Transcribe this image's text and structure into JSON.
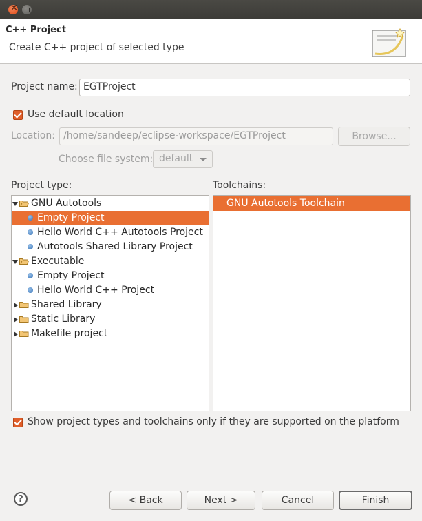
{
  "window": {
    "close_icon": "close-icon",
    "minimize_icon": "minimize-icon"
  },
  "header": {
    "title": "C++ Project",
    "description": "Create C++ project of selected type"
  },
  "project_name": {
    "label": "Project name:",
    "value": "EGTProject"
  },
  "use_default_location": {
    "label": "Use default location",
    "checked": true
  },
  "location": {
    "label": "Location:",
    "value": "/home/sandeep/eclipse-workspace/EGTProject",
    "browse_label": "Browse..."
  },
  "file_system": {
    "label": "Choose file system:",
    "value": "default"
  },
  "project_type": {
    "label": "Project type:",
    "items": [
      {
        "text": "GNU Autotools",
        "kind": "folder",
        "expanded": true,
        "depth": 0
      },
      {
        "text": "Empty Project",
        "kind": "item",
        "depth": 1,
        "selected": true
      },
      {
        "text": "Hello World C++ Autotools Project",
        "kind": "item",
        "depth": 1
      },
      {
        "text": "Autotools Shared Library Project",
        "kind": "item",
        "depth": 1
      },
      {
        "text": "Executable",
        "kind": "folder",
        "expanded": true,
        "depth": 0
      },
      {
        "text": "Empty Project",
        "kind": "item",
        "depth": 1
      },
      {
        "text": "Hello World C++ Project",
        "kind": "item",
        "depth": 1
      },
      {
        "text": "Shared Library",
        "kind": "folder",
        "expanded": false,
        "depth": 0
      },
      {
        "text": "Static Library",
        "kind": "folder",
        "expanded": false,
        "depth": 0
      },
      {
        "text": "Makefile project",
        "kind": "folder",
        "expanded": false,
        "depth": 0
      }
    ]
  },
  "toolchains": {
    "label": "Toolchains:",
    "items": [
      {
        "text": "GNU Autotools Toolchain",
        "selected": true
      }
    ]
  },
  "show_supported": {
    "label": "Show project types and toolchains only if they are supported on the platform",
    "checked": true
  },
  "buttons": {
    "back": "< Back",
    "next": "Next >",
    "cancel": "Cancel",
    "finish": "Finish"
  },
  "help": {
    "icon": "help-icon",
    "glyph": "?"
  },
  "colors": {
    "accent": "#e96f32",
    "titlebar": "#3c3b37"
  }
}
